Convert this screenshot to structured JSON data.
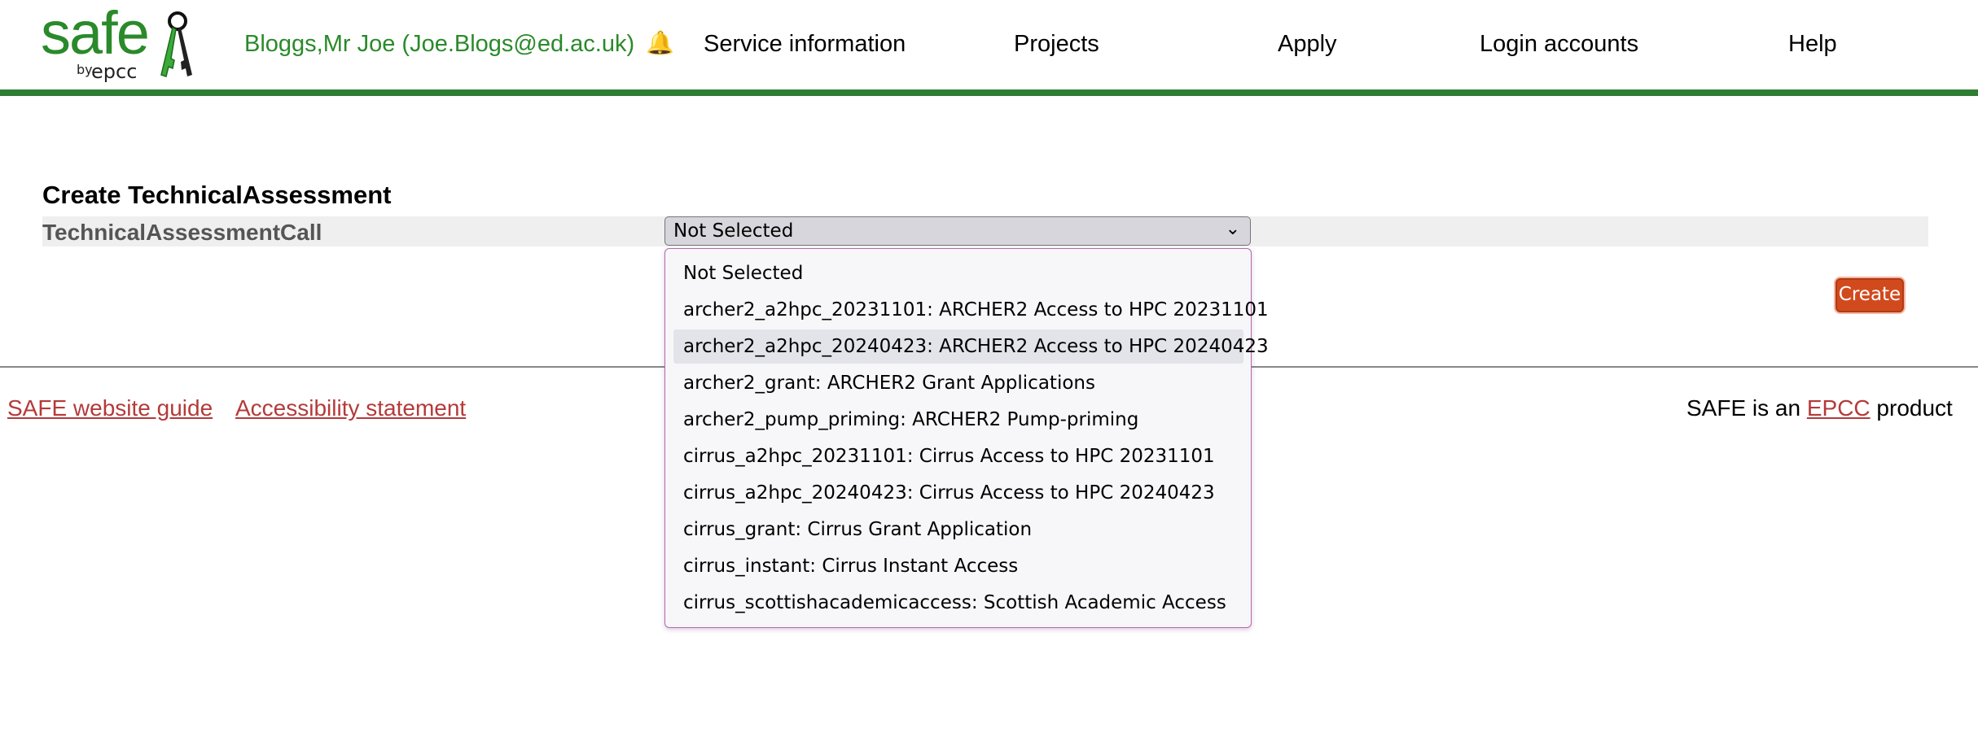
{
  "header": {
    "logo_text": "safe",
    "logo_by": "by",
    "logo_company": "epcc",
    "user": "Bloggs,Mr Joe (Joe.Blogs@ed.ac.uk)",
    "bell_icon": "🔔",
    "nav": [
      {
        "label": "Service information"
      },
      {
        "label": "Projects"
      },
      {
        "label": "Apply"
      },
      {
        "label": "Login accounts"
      },
      {
        "label": "Help"
      }
    ]
  },
  "main": {
    "title": "Create TechnicalAssessment",
    "field_label": "TechnicalAssessmentCall",
    "select_value": "Not Selected",
    "create_label": "Create"
  },
  "dropdown": {
    "options": [
      {
        "label": "Not Selected"
      },
      {
        "label": "archer2_a2hpc_20231101: ARCHER2 Access to HPC 20231101"
      },
      {
        "label": "archer2_a2hpc_20240423: ARCHER2 Access to HPC 20240423",
        "highlighted": true
      },
      {
        "label": "archer2_grant: ARCHER2 Grant Applications"
      },
      {
        "label": "archer2_pump_priming: ARCHER2 Pump-priming"
      },
      {
        "label": "cirrus_a2hpc_20231101: Cirrus Access to HPC 20231101"
      },
      {
        "label": "cirrus_a2hpc_20240423: Cirrus Access to HPC 20240423"
      },
      {
        "label": "cirrus_grant: Cirrus Grant Application"
      },
      {
        "label": "cirrus_instant: Cirrus Instant Access"
      },
      {
        "label": "cirrus_scottishacademicaccess: Scottish Academic Access"
      }
    ]
  },
  "footer": {
    "guide_link": "SAFE website guide",
    "accessibility_link": "Accessibility statement",
    "product_prefix": "SAFE is an ",
    "product_link": "EPCC",
    "product_suffix": " product"
  },
  "colors": {
    "brand_green": "#2e7d32",
    "create_button": "#d14a1e",
    "link": "#b43a3a"
  }
}
